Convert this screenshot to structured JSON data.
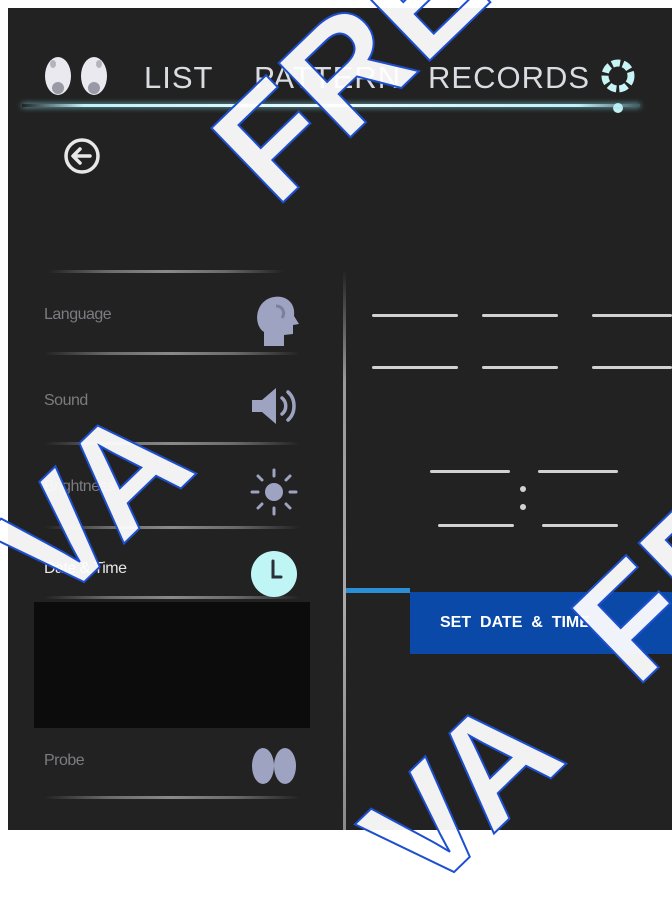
{
  "nav": {
    "tabs": [
      {
        "label": "LIST"
      },
      {
        "label": "PATTERN"
      },
      {
        "label": "RECORDS"
      }
    ],
    "icons": {
      "logo": "footprints-icon",
      "settings": "gear-icon",
      "back": "back-arrow-icon"
    }
  },
  "sidebar": {
    "items": [
      {
        "label": "Language",
        "icon": "head-profile-icon",
        "active": false
      },
      {
        "label": "Sound",
        "icon": "speaker-icon",
        "active": false
      },
      {
        "label": "Brightness",
        "icon": "sun-icon",
        "active": false
      },
      {
        "label": "Date & Time",
        "icon": "clock-icon",
        "active": true
      },
      {
        "label": "Probe",
        "icon": "footprints-icon",
        "active": false
      }
    ]
  },
  "main": {
    "set_button_label": "SET  DATE  &  TIME"
  },
  "watermark": {
    "text_top": "FRESH",
    "text_left": "VA",
    "text_bottom": "VA",
    "text_right": "FR"
  },
  "colors": {
    "background": "#222222",
    "accent_line": "#bff2f7",
    "button": "#0a49a8",
    "button_accent": "#2b8fd8",
    "clock_icon": "#bff5f5"
  }
}
